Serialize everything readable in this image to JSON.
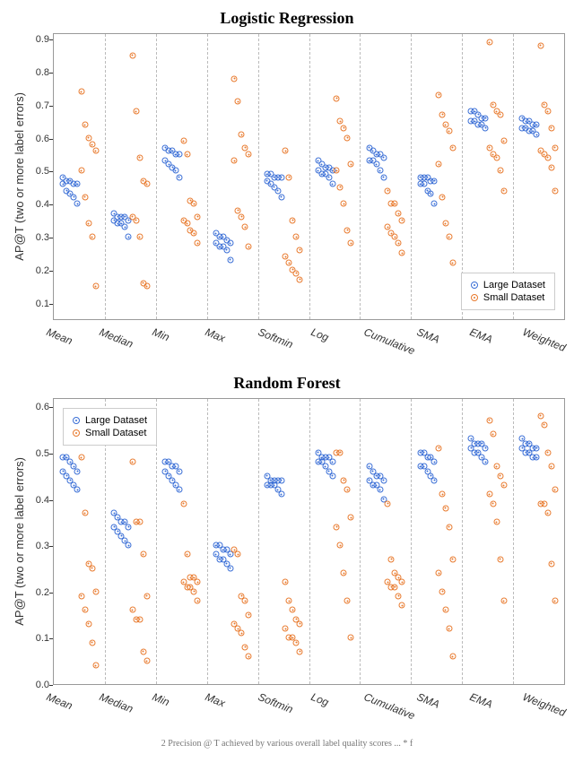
{
  "chart_data": [
    {
      "type": "scatter",
      "title": "Logistic Regression",
      "ylabel": "AP@T (two or more label errors)",
      "ylim": [
        0.05,
        0.92
      ],
      "yticks": [
        0.1,
        0.2,
        0.3,
        0.4,
        0.5,
        0.6,
        0.7,
        0.8,
        0.9
      ],
      "categories": [
        "Mean",
        "Median",
        "Min",
        "Max",
        "Softmin",
        "Log",
        "Cumulative",
        "SMA",
        "EMA",
        "Weighted"
      ],
      "legend_pos": "bottom-right",
      "series": [
        {
          "name": "Large Dataset",
          "color": "#3b6fd6",
          "values": {
            "Mean": [
              0.48,
              0.47,
              0.47,
              0.46,
              0.46,
              0.46,
              0.44,
              0.43,
              0.42,
              0.4
            ],
            "Median": [
              0.37,
              0.36,
              0.36,
              0.36,
              0.35,
              0.35,
              0.34,
              0.34,
              0.33,
              0.3
            ],
            "Min": [
              0.57,
              0.56,
              0.56,
              0.55,
              0.55,
              0.53,
              0.52,
              0.51,
              0.5,
              0.48
            ],
            "Max": [
              0.31,
              0.3,
              0.3,
              0.29,
              0.28,
              0.28,
              0.27,
              0.27,
              0.26,
              0.23
            ],
            "Softmin": [
              0.49,
              0.49,
              0.48,
              0.48,
              0.48,
              0.47,
              0.46,
              0.45,
              0.44,
              0.42
            ],
            "Log": [
              0.53,
              0.52,
              0.51,
              0.51,
              0.5,
              0.5,
              0.49,
              0.49,
              0.48,
              0.46
            ],
            "Cumulative": [
              0.57,
              0.56,
              0.55,
              0.55,
              0.54,
              0.53,
              0.53,
              0.52,
              0.5,
              0.48
            ],
            "SMA": [
              0.48,
              0.48,
              0.48,
              0.47,
              0.47,
              0.46,
              0.46,
              0.44,
              0.43,
              0.4
            ],
            "EMA": [
              0.68,
              0.68,
              0.67,
              0.66,
              0.66,
              0.65,
              0.65,
              0.64,
              0.64,
              0.63
            ],
            "Weighted": [
              0.66,
              0.65,
              0.65,
              0.64,
              0.64,
              0.63,
              0.63,
              0.62,
              0.62,
              0.61
            ]
          }
        },
        {
          "name": "Small Dataset",
          "color": "#e87a2e",
          "values": {
            "Mean": [
              0.74,
              0.64,
              0.6,
              0.58,
              0.56,
              0.5,
              0.42,
              0.34,
              0.3,
              0.15
            ],
            "Median": [
              0.85,
              0.68,
              0.54,
              0.47,
              0.46,
              0.36,
              0.35,
              0.3,
              0.16,
              0.15
            ],
            "Min": [
              0.59,
              0.55,
              0.41,
              0.4,
              0.36,
              0.35,
              0.34,
              0.32,
              0.31,
              0.28
            ],
            "Max": [
              0.78,
              0.71,
              0.61,
              0.57,
              0.55,
              0.53,
              0.38,
              0.36,
              0.33,
              0.27
            ],
            "Softmin": [
              0.56,
              0.48,
              0.35,
              0.3,
              0.26,
              0.24,
              0.22,
              0.2,
              0.19,
              0.17
            ],
            "Log": [
              0.72,
              0.65,
              0.63,
              0.6,
              0.52,
              0.5,
              0.45,
              0.4,
              0.32,
              0.28
            ],
            "Cumulative": [
              0.44,
              0.4,
              0.4,
              0.37,
              0.35,
              0.33,
              0.31,
              0.3,
              0.28,
              0.25
            ],
            "SMA": [
              0.73,
              0.67,
              0.64,
              0.62,
              0.57,
              0.52,
              0.42,
              0.34,
              0.3,
              0.22
            ],
            "EMA": [
              0.89,
              0.7,
              0.68,
              0.67,
              0.59,
              0.57,
              0.55,
              0.54,
              0.5,
              0.44
            ],
            "Weighted": [
              0.88,
              0.7,
              0.68,
              0.63,
              0.57,
              0.56,
              0.55,
              0.54,
              0.51,
              0.44
            ]
          }
        }
      ]
    },
    {
      "type": "scatter",
      "title": "Random Forest",
      "ylabel": "AP@T (two or more label errors)",
      "ylim": [
        0.0,
        0.62
      ],
      "yticks": [
        0.0,
        0.1,
        0.2,
        0.3,
        0.4,
        0.5,
        0.6
      ],
      "categories": [
        "Mean",
        "Median",
        "Min",
        "Max",
        "Softmin",
        "Log",
        "Cumulative",
        "SMA",
        "EMA",
        "Weighted"
      ],
      "legend_pos": "top-left",
      "series": [
        {
          "name": "Large Dataset",
          "color": "#3b6fd6",
          "values": {
            "Mean": [
              0.49,
              0.49,
              0.48,
              0.47,
              0.46,
              0.46,
              0.45,
              0.44,
              0.43,
              0.42
            ],
            "Median": [
              0.37,
              0.36,
              0.35,
              0.35,
              0.34,
              0.34,
              0.33,
              0.32,
              0.31,
              0.3
            ],
            "Min": [
              0.48,
              0.48,
              0.47,
              0.47,
              0.46,
              0.46,
              0.45,
              0.44,
              0.43,
              0.42
            ],
            "Max": [
              0.3,
              0.3,
              0.29,
              0.29,
              0.28,
              0.28,
              0.27,
              0.27,
              0.26,
              0.25
            ],
            "Softmin": [
              0.45,
              0.44,
              0.44,
              0.44,
              0.44,
              0.43,
              0.43,
              0.43,
              0.42,
              0.41
            ],
            "Log": [
              0.5,
              0.49,
              0.49,
              0.49,
              0.48,
              0.48,
              0.48,
              0.47,
              0.46,
              0.45
            ],
            "Cumulative": [
              0.47,
              0.46,
              0.45,
              0.45,
              0.44,
              0.44,
              0.43,
              0.43,
              0.42,
              0.4
            ],
            "SMA": [
              0.5,
              0.5,
              0.49,
              0.49,
              0.48,
              0.47,
              0.47,
              0.46,
              0.45,
              0.44
            ],
            "EMA": [
              0.53,
              0.52,
              0.52,
              0.52,
              0.51,
              0.51,
              0.5,
              0.5,
              0.49,
              0.48
            ],
            "Weighted": [
              0.53,
              0.52,
              0.52,
              0.51,
              0.51,
              0.51,
              0.5,
              0.5,
              0.49,
              0.49
            ]
          }
        },
        {
          "name": "Small Dataset",
          "color": "#e87a2e",
          "values": {
            "Mean": [
              0.49,
              0.37,
              0.26,
              0.25,
              0.2,
              0.19,
              0.16,
              0.13,
              0.09,
              0.04
            ],
            "Median": [
              0.48,
              0.35,
              0.35,
              0.28,
              0.19,
              0.16,
              0.14,
              0.14,
              0.07,
              0.05
            ],
            "Min": [
              0.39,
              0.28,
              0.23,
              0.23,
              0.22,
              0.22,
              0.21,
              0.21,
              0.2,
              0.18
            ],
            "Max": [
              0.29,
              0.28,
              0.19,
              0.18,
              0.15,
              0.13,
              0.12,
              0.11,
              0.08,
              0.06
            ],
            "Softmin": [
              0.22,
              0.18,
              0.16,
              0.14,
              0.13,
              0.12,
              0.1,
              0.1,
              0.09,
              0.07
            ],
            "Log": [
              0.5,
              0.5,
              0.44,
              0.42,
              0.36,
              0.34,
              0.3,
              0.24,
              0.18,
              0.1
            ],
            "Cumulative": [
              0.39,
              0.27,
              0.24,
              0.23,
              0.22,
              0.22,
              0.21,
              0.21,
              0.19,
              0.17
            ],
            "SMA": [
              0.51,
              0.41,
              0.38,
              0.34,
              0.27,
              0.24,
              0.2,
              0.16,
              0.12,
              0.06
            ],
            "EMA": [
              0.57,
              0.54,
              0.47,
              0.45,
              0.43,
              0.41,
              0.39,
              0.35,
              0.27,
              0.18
            ],
            "Weighted": [
              0.58,
              0.56,
              0.5,
              0.47,
              0.42,
              0.39,
              0.39,
              0.37,
              0.26,
              0.18
            ]
          }
        }
      ]
    }
  ],
  "caption_hint": "2 Precision @ T achieved by various overall label quality scores ... * f"
}
